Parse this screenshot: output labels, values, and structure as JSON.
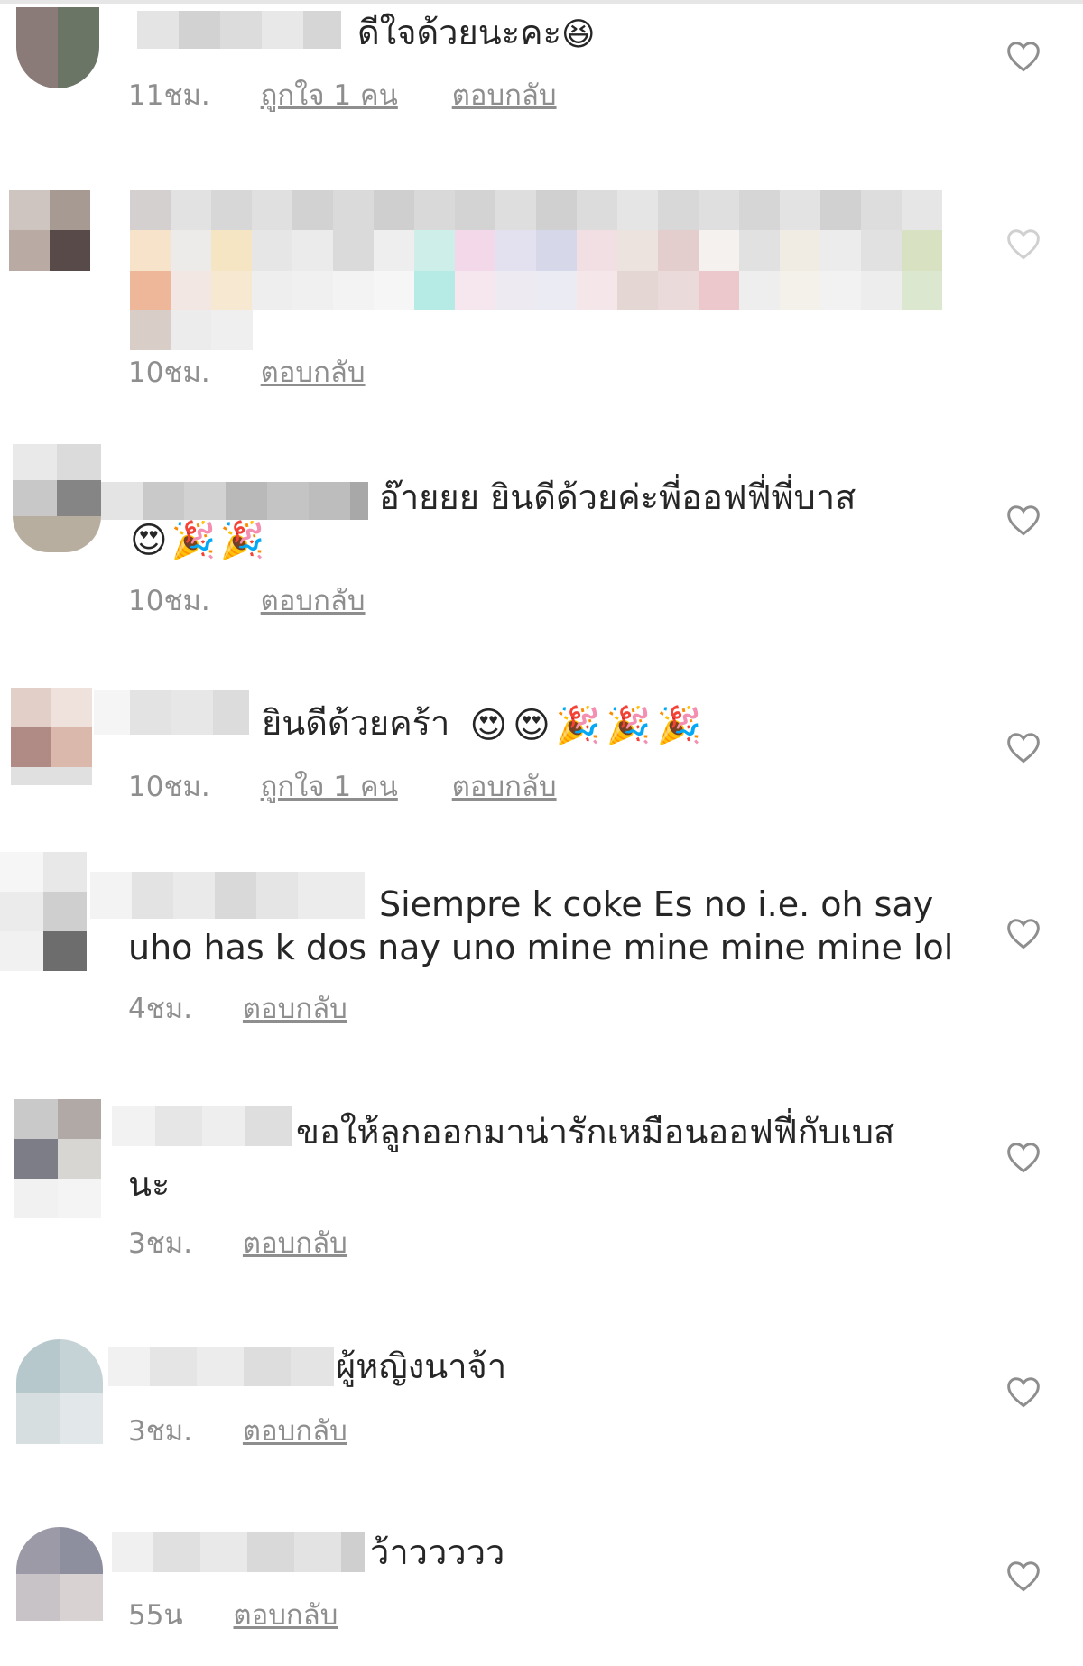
{
  "comments": [
    {
      "text": "ดีใจด้วยนะคะ",
      "emoji": "😆",
      "time": "11ชม.",
      "likes": "ถูกใจ 1 คน",
      "reply": "ตอบกลับ"
    },
    {
      "text": "",
      "time": "10ชม.",
      "reply": "ตอบกลับ"
    },
    {
      "text_line1": "อ๊ายยย ยินดีด้วยค่ะพี่ออฟฟี่พี่บาส",
      "emoji_line2": "😍🎉🎉",
      "time": "10ชม.",
      "reply": "ตอบกลับ"
    },
    {
      "text": "ยินดีด้วยคร้า",
      "emoji": "😍😍🎉🎉🎉",
      "time": "10ชม.",
      "likes": "ถูกใจ 1 คน",
      "reply": "ตอบกลับ"
    },
    {
      "text_line1": "Siempre k coke Es no i.e. oh say",
      "text_line2": "uho has k dos nay uno mine mine mine mine lol",
      "time": "4ชม.",
      "reply": "ตอบกลับ"
    },
    {
      "text_line1": "ขอให้ลูกออกมาน่ารักเหมือนออฟฟี่กับเบส",
      "text_line2": "นะ",
      "time": "3ชม.",
      "reply": "ตอบกลับ"
    },
    {
      "text": "ผู้หญิงนาจ้า",
      "time": "3ชม.",
      "reply": "ตอบกลับ"
    },
    {
      "text": "ว้าววววว",
      "time": "55น",
      "reply": "ตอบกลับ"
    }
  ],
  "icons": {
    "like": "heart-outline-icon"
  },
  "colors": {
    "text": "#262626",
    "meta": "#8e8e8e",
    "heart": "#8e8e8e"
  }
}
